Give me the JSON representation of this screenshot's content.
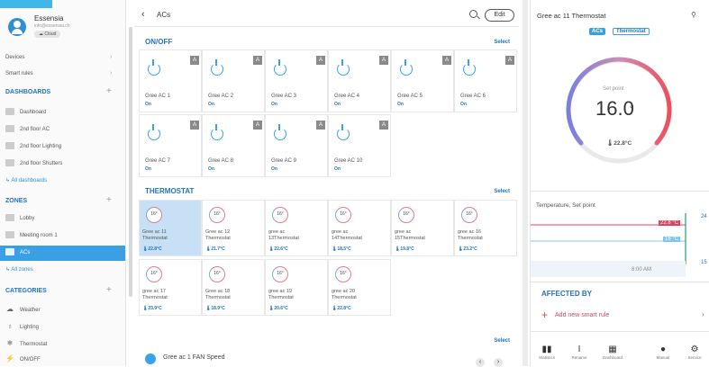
{
  "sidebar": {
    "profile": {
      "name": "Essensia",
      "email": "info@essensia.ch",
      "cloud": "Cloud"
    },
    "devices": "Devices",
    "smart_rules": "Smart rules",
    "dashboards_title": "DASHBOARDS",
    "dashboards": [
      "Dashboard",
      "2nd floor AC",
      "2nd floor Lighting",
      "2nd floor Shutters"
    ],
    "all_dashboards": "All dashboards",
    "zones_title": "ZONES",
    "zones": [
      "Lobby",
      "Meeting room 1",
      "ACs"
    ],
    "all_zones": "All zones",
    "categories_title": "CATEGORIES",
    "categories": [
      {
        "label": "Weather",
        "icon": "cloud-icon"
      },
      {
        "label": "Lighting",
        "icon": "bulb-icon"
      },
      {
        "label": "Thermostat",
        "icon": "thermostat-icon"
      },
      {
        "label": "ON/OFF",
        "icon": "plug-icon"
      }
    ]
  },
  "main": {
    "title": "ACs",
    "edit": "Edit",
    "onoff_title": "ON/OFF",
    "select": "Select",
    "ac_cards": [
      {
        "name": "Gree AC 1",
        "state": "On",
        "badge": "A"
      },
      {
        "name": "Gree AC 2",
        "state": "On",
        "badge": "A"
      },
      {
        "name": "Gree AC 3",
        "state": "On",
        "badge": "A"
      },
      {
        "name": "Gree AC 4",
        "state": "On",
        "badge": "A"
      },
      {
        "name": "Gree AC 5",
        "state": "On",
        "badge": "A"
      },
      {
        "name": "Gree AC 6",
        "state": "On",
        "badge": "A"
      },
      {
        "name": "Gree AC 7",
        "state": "On",
        "badge": "A"
      },
      {
        "name": "Gree AC 8",
        "state": "On",
        "badge": "A"
      },
      {
        "name": "Gree AC 9",
        "state": "On",
        "badge": "A"
      },
      {
        "name": "Gree AC 10",
        "state": "On",
        "badge": "A"
      }
    ],
    "thermostat_title": "THERMOSTAT",
    "thermostats": [
      {
        "set": "16°",
        "name1": "Gree ac 11",
        "name2": "Thermostat",
        "temp": "22.8°C"
      },
      {
        "set": "16°",
        "name1": "Gree ac 12",
        "name2": "Thermostat",
        "temp": "21.7°C"
      },
      {
        "set": "16°",
        "name1": "gree ac",
        "name2": "13Thermostat",
        "temp": "22.6°C"
      },
      {
        "set": "16°",
        "name1": "gree ac",
        "name2": "14Thermostat",
        "temp": "18.5°C"
      },
      {
        "set": "16°",
        "name1": "gree ac",
        "name2": "15Thermostat",
        "temp": "19.8°C"
      },
      {
        "set": "16°",
        "name1": "gree ac 16",
        "name2": "Thermostat",
        "temp": "23.2°C"
      },
      {
        "set": "16°",
        "name1": "gree ac 17",
        "name2": "Thermostat",
        "temp": "23.9°C"
      },
      {
        "set": "16°",
        "name1": "Gree ac 18",
        "name2": "Thermostat",
        "temp": "18.9°C"
      },
      {
        "set": "16°",
        "name1": "gree ac 19",
        "name2": "Thermostat",
        "temp": "20.6°C"
      },
      {
        "set": "16°",
        "name1": "gree ac 20",
        "name2": "Thermostat",
        "temp": "22.8°C"
      }
    ],
    "select2": "Select",
    "fan_label": "Gree ac 1 FAN Speed"
  },
  "right": {
    "title": "Gree ac 11 Thermostat",
    "tag1": "ACs",
    "tag2": "Thermostat",
    "set_label": "Set point",
    "set_value": "16.0",
    "set_unit": "°",
    "current": "22.8°C",
    "chart_label": "Temperature, Set point",
    "chart_val1": "22.8 °C",
    "chart_val2": "16 °C",
    "axis_24": "24",
    "axis_15": "15",
    "time": "8:00 AM",
    "affected_title": "AFFECTED BY",
    "add_rule": "Add new smart rule",
    "bottom_icons": [
      {
        "label": "Statistics",
        "icon": "stats-icon"
      },
      {
        "label": "Rename",
        "icon": "rename-icon"
      },
      {
        "label": "Dashboard",
        "icon": "dashboard-icon"
      },
      {
        "label": "Manual",
        "icon": "user-icon"
      },
      {
        "label": "Service",
        "icon": "gear-icon"
      }
    ]
  },
  "colors": {
    "accent": "#2073c4",
    "selected": "#3ba0e3",
    "highlight": "#c7e0f5",
    "red": "#e0425c"
  }
}
